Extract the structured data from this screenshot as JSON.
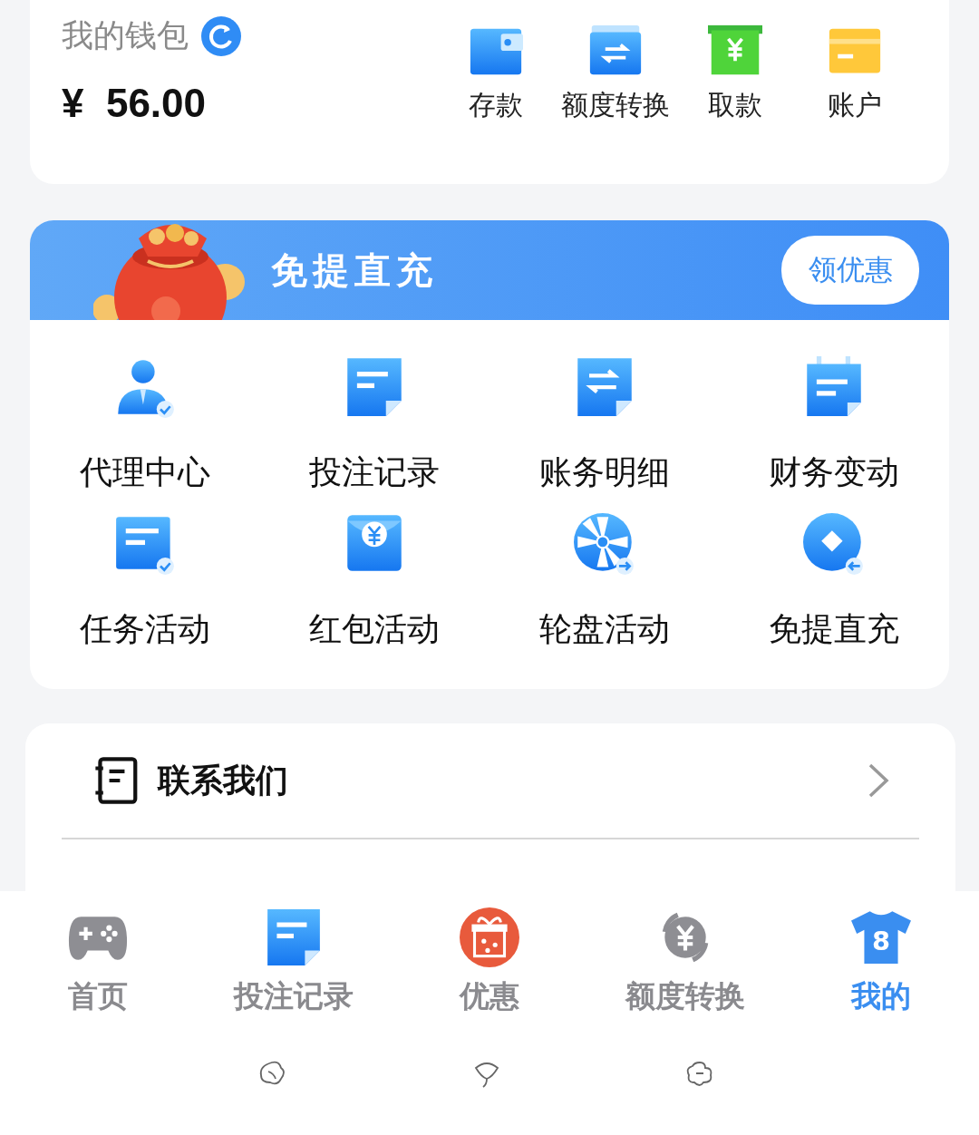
{
  "wallet": {
    "title": "我的钱包",
    "balance": "¥  56.00",
    "actions": [
      {
        "label": "存款",
        "kind": "wallet"
      },
      {
        "label": "额度转换",
        "kind": "transfer"
      },
      {
        "label": "取款",
        "kind": "withdraw"
      },
      {
        "label": "账户",
        "kind": "card"
      }
    ]
  },
  "promo": {
    "title": "免提直充",
    "button": "领优惠",
    "features": [
      {
        "label": "代理中心",
        "kind": "agent"
      },
      {
        "label": "投注记录",
        "kind": "note"
      },
      {
        "label": "账务明细",
        "kind": "notearrow"
      },
      {
        "label": "财务变动",
        "kind": "calendar"
      },
      {
        "label": "任务活动",
        "kind": "task"
      },
      {
        "label": "红包活动",
        "kind": "envelope"
      },
      {
        "label": "轮盘活动",
        "kind": "wheel"
      },
      {
        "label": "免提直充",
        "kind": "coin"
      }
    ]
  },
  "menu": [
    {
      "label": "联系我们",
      "kind": "contact"
    }
  ],
  "tabs": [
    {
      "label": "首页",
      "kind": "gamepad",
      "selected": false
    },
    {
      "label": "投注记录",
      "kind": "note",
      "selected": false
    },
    {
      "label": "优惠",
      "kind": "gift",
      "selected": false
    },
    {
      "label": "额度转换",
      "kind": "exchange",
      "selected": false
    },
    {
      "label": "我的",
      "kind": "shirt",
      "icon_text": "8",
      "selected": true
    }
  ]
}
